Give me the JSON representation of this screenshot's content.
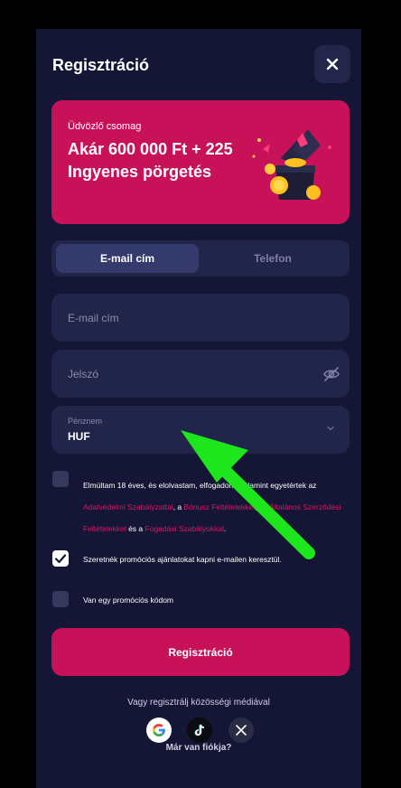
{
  "modal": {
    "title": "Regisztráció",
    "close_icon": "close-icon"
  },
  "promo": {
    "label": "Üdvözlő csomag",
    "title": "Akár 600 000 Ft + 225 Ingyenes pörgetés",
    "art_icon": "gift-box-coins-illustration",
    "color": "#c7125a"
  },
  "tabs": [
    {
      "label": "E-mail cím",
      "active": true
    },
    {
      "label": "Telefon",
      "active": false
    }
  ],
  "fields": {
    "email": {
      "placeholder": "E-mail cím",
      "value": ""
    },
    "password": {
      "placeholder": "Jelszó",
      "value": "",
      "icon": "eye-off-icon"
    },
    "currency": {
      "label": "Pénznem",
      "value": "HUF",
      "icon": "chevron-down-icon"
    }
  },
  "consent": {
    "checked": false,
    "text_1": "Elmúltam 18 éves, és elolvastam,",
    "text_hidden": " elfogadom,",
    "text_2": " valamint egyetértek az",
    "link_privacy": "Adatvédelmi Szabályzattal",
    "text_3": ", a",
    "link_bonus": "Bónusz Feltételekkel",
    "text_4": ", az",
    "link_general": "Általános Szerződési Feltételekkel",
    "text_5": " és a",
    "link_betting": "Fogadási Szabályokkal",
    "text_6": "."
  },
  "promo_emails": {
    "checked": true,
    "label": "Szeretnék promóciós ajánlatokat kapni e-mailen keresztül."
  },
  "promo_code": {
    "checked": false,
    "label": "Van egy promóciós kódom"
  },
  "submit_label": "Regisztráció",
  "social_caption": "Vagy regisztrálj közösségi médiával",
  "social": [
    {
      "name": "google-icon"
    },
    {
      "name": "tiktok-icon"
    },
    {
      "name": "x-icon"
    }
  ],
  "login_caption": "Már van fiókja?",
  "colors": {
    "background": "#151635",
    "accent": "#c7125a",
    "input": "#22254a",
    "annotation_arrow": "#1de61d"
  },
  "annotation": {
    "type": "arrow",
    "points_to": "currency-selector"
  }
}
